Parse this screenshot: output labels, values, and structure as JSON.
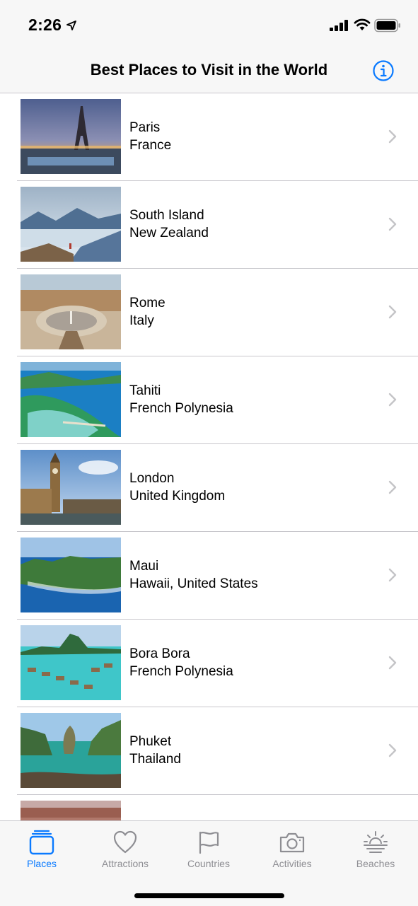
{
  "status_bar": {
    "time": "2:26"
  },
  "nav": {
    "title": "Best Places to Visit in the World"
  },
  "places": [
    {
      "name": "Paris",
      "location": "France"
    },
    {
      "name": "South Island",
      "location": "New Zealand"
    },
    {
      "name": "Rome",
      "location": "Italy"
    },
    {
      "name": "Tahiti",
      "location": "French Polynesia"
    },
    {
      "name": "London",
      "location": "United Kingdom"
    },
    {
      "name": "Maui",
      "location": "Hawaii, United States"
    },
    {
      "name": "Bora Bora",
      "location": "French Polynesia"
    },
    {
      "name": "Phuket",
      "location": "Thailand"
    }
  ],
  "tabs": [
    {
      "label": "Places",
      "icon": "places-icon",
      "active": true
    },
    {
      "label": "Attractions",
      "icon": "heart-icon",
      "active": false
    },
    {
      "label": "Countries",
      "icon": "flag-icon",
      "active": false
    },
    {
      "label": "Activities",
      "icon": "camera-icon",
      "active": false
    },
    {
      "label": "Beaches",
      "icon": "sunset-icon",
      "active": false
    }
  ],
  "colors": {
    "accent": "#0a7aff",
    "inactive": "#8e8e93",
    "separator": "#c8c7cc"
  }
}
